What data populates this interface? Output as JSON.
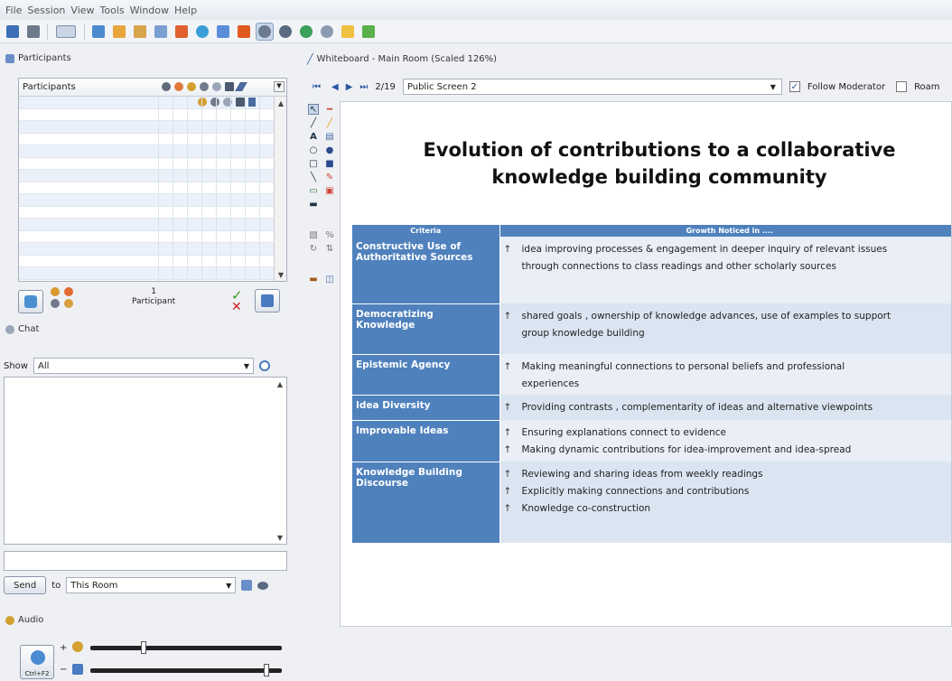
{
  "menu": [
    "File",
    "Session",
    "View",
    "Tools",
    "Window",
    "Help"
  ],
  "participants_panel": {
    "title": "Participants",
    "column_header": "Participants",
    "count": "1",
    "count_label": "Participant"
  },
  "chat": {
    "title": "Chat",
    "show_label": "Show",
    "show_value": "All",
    "send_label": "Send",
    "to_label": "to",
    "room_value": "This Room"
  },
  "audio": {
    "title": "Audio",
    "talk_shortcut": "Ctrl+F2",
    "mic_level": 0.28,
    "speaker_level": 0.92
  },
  "whiteboard": {
    "title": "Whiteboard - Main Room (Scaled 126%)",
    "page_indicator": "2/19",
    "page_name": "Public Screen 2",
    "follow_label": "Follow Moderator",
    "follow_checked": true,
    "roam_label": "Roam"
  },
  "slide": {
    "title_line1": "Evolution of contributions to a collaborative",
    "title_line2": "knowledge building community",
    "table_headers": [
      "Criteria",
      "Growth Noticed in ...."
    ],
    "rows": [
      {
        "criteria": "Constructive Use of Authoritative Sources",
        "lines": [
          "idea improving processes & engagement in deeper inquiry of relevant issues",
          "through connections to class readings and other scholarly sources"
        ],
        "arrows": [
          true,
          false
        ]
      },
      {
        "criteria": "Democratizing Knowledge",
        "lines": [
          "shared goals , ownership of knowledge advances, use of examples  to support",
          "group knowledge building"
        ],
        "arrows": [
          true,
          false
        ]
      },
      {
        "criteria": "Epistemic Agency",
        "lines": [
          "Making meaningful connections to personal beliefs and professional",
          "experiences"
        ],
        "arrows": [
          true,
          false
        ]
      },
      {
        "criteria": "Idea Diversity",
        "lines": [
          "Providing contrasts , complementarity of ideas and alternative viewpoints"
        ],
        "arrows": [
          true
        ]
      },
      {
        "criteria": "Improvable Ideas",
        "lines": [
          "Ensuring explanations connect to evidence",
          "Making dynamic contributions for idea-improvement and idea-spread"
        ],
        "arrows": [
          true,
          true
        ]
      },
      {
        "criteria": "Knowledge Building Discourse",
        "lines": [
          "Reviewing and sharing ideas from weekly readings",
          "Explicitly making connections and contributions",
          "Knowledge co-construction"
        ],
        "arrows": [
          true,
          true,
          true
        ]
      }
    ]
  }
}
